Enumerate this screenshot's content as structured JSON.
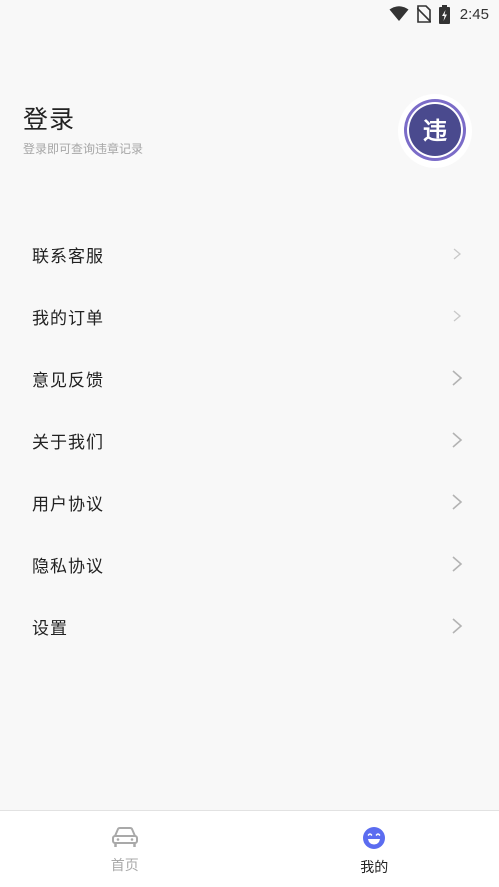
{
  "status_bar": {
    "time": "2:45",
    "icons": [
      "wifi-icon",
      "no-sim-icon",
      "battery-charging-icon"
    ]
  },
  "login": {
    "title": "登录",
    "subtitle": "登录即可查询违章记录",
    "logo_text": "违"
  },
  "menu": {
    "items": [
      {
        "label": "联系客服"
      },
      {
        "label": "我的订单"
      },
      {
        "label": "意见反馈"
      },
      {
        "label": "关于我们"
      },
      {
        "label": "用户协议"
      },
      {
        "label": "隐私协议"
      },
      {
        "label": "设置"
      }
    ]
  },
  "bottom_nav": {
    "tabs": [
      {
        "label": "首页",
        "icon": "car-icon",
        "active": false
      },
      {
        "label": "我的",
        "icon": "smiley-icon",
        "active": true
      }
    ]
  },
  "colors": {
    "accent": "#4a4a9a",
    "logo_ring": "#7b6cc8",
    "inactive": "#a9a9a9",
    "nav_active_icon": "#5b6cf0"
  }
}
